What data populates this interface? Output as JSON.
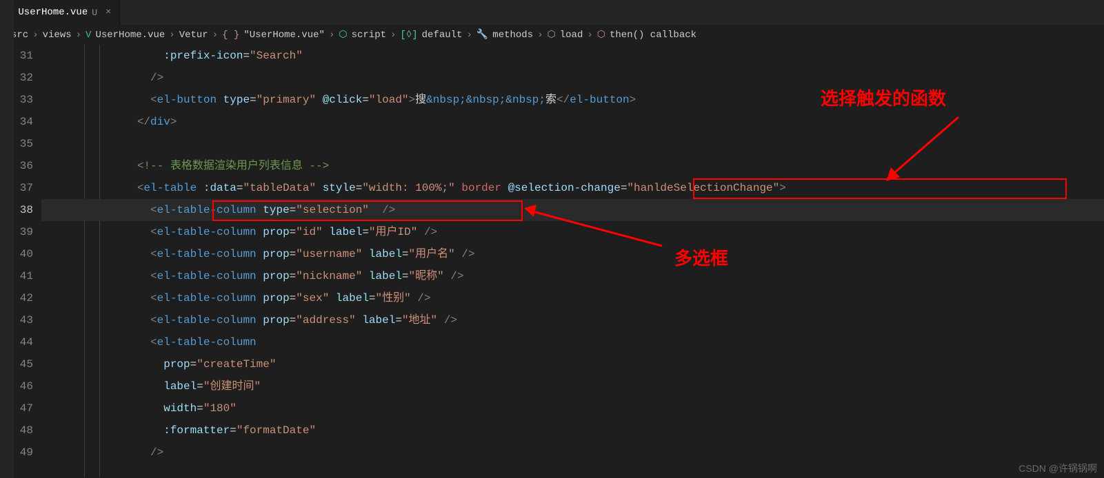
{
  "tab": {
    "icon": "V",
    "filename": "UserHome.vue",
    "modified": "U",
    "close": "×"
  },
  "breadcrumb": {
    "items": [
      "src",
      "views",
      "UserHome.vue",
      "Vetur",
      "\"UserHome.vue\"",
      "script",
      "default",
      "methods",
      "load",
      "then() callback"
    ],
    "sep": "›"
  },
  "gutter": [
    "31",
    "32",
    "33",
    "34",
    "35",
    "36",
    "37",
    "38",
    "39",
    "40",
    "41",
    "42",
    "43",
    "44",
    "45",
    "46",
    "47",
    "48",
    "49"
  ],
  "code": {
    "l31": {
      "attr": ":prefix-icon",
      "eq": "=",
      "val": "\"Search\""
    },
    "l32": {
      "close": "/>"
    },
    "l33": {
      "lt": "<",
      "tag": "el-button",
      "a1": "type",
      "v1": "\"primary\"",
      "a2": "@click",
      "v2": "\"load\"",
      "gt": ">",
      "txt1": "搜",
      "amp": "&nbsp;&nbsp;&nbsp;",
      "txt2": "索",
      "lt2": "</",
      "tag2": "el-button",
      "gt2": ">"
    },
    "l34": {
      "lt": "</",
      "tag": "div",
      "gt": ">"
    },
    "l36": {
      "comment": "<!-- 表格数据渲染用户列表信息 -->"
    },
    "l37": {
      "lt": "<",
      "tag": "el-table",
      "a1": ":data",
      "v1": "\"tableData\"",
      "a2": "style",
      "v2": "\"width: 100%;\"",
      "border": "border",
      "a3": "@selection-change",
      "v3": "\"hanldeSelectionChange\"",
      "gt": ">"
    },
    "l38": {
      "lt": "<",
      "tag": "el-table-column",
      "a1": "type",
      "v1": "\"selection\"",
      "close": "  />"
    },
    "l39": {
      "lt": "<",
      "tag": "el-table-column",
      "a1": "prop",
      "v1": "\"id\"",
      "a2": "label",
      "v2": "\"用户ID\"",
      "close": " />"
    },
    "l40": {
      "lt": "<",
      "tag": "el-table-column",
      "a1": "prop",
      "v1": "\"username\"",
      "a2": "label",
      "v2": "\"用户名\"",
      "close": " />"
    },
    "l41": {
      "lt": "<",
      "tag": "el-table-column",
      "a1": "prop",
      "v1": "\"nickname\"",
      "a2": "label",
      "v2": "\"昵称\"",
      "close": " />"
    },
    "l42": {
      "lt": "<",
      "tag": "el-table-column",
      "a1": "prop",
      "v1": "\"sex\"",
      "a2": "label",
      "v2": "\"性别\"",
      "close": " />"
    },
    "l43": {
      "lt": "<",
      "tag": "el-table-column",
      "a1": "prop",
      "v1": "\"address\"",
      "a2": "label",
      "v2": "\"地址\"",
      "close": " />"
    },
    "l44": {
      "lt": "<",
      "tag": "el-table-column"
    },
    "l45": {
      "a1": "prop",
      "v1": "\"createTime\""
    },
    "l46": {
      "a1": "label",
      "v1": "\"创建时间\""
    },
    "l47": {
      "a1": "width",
      "v1": "\"180\""
    },
    "l48": {
      "a1": ":formatter",
      "v1": "\"formatDate\""
    },
    "l49": {
      "close": "/>"
    }
  },
  "annotations": {
    "fn": "选择触发的函数",
    "checkbox": "多选框"
  },
  "watermark": "CSDN @许锅锅啊"
}
